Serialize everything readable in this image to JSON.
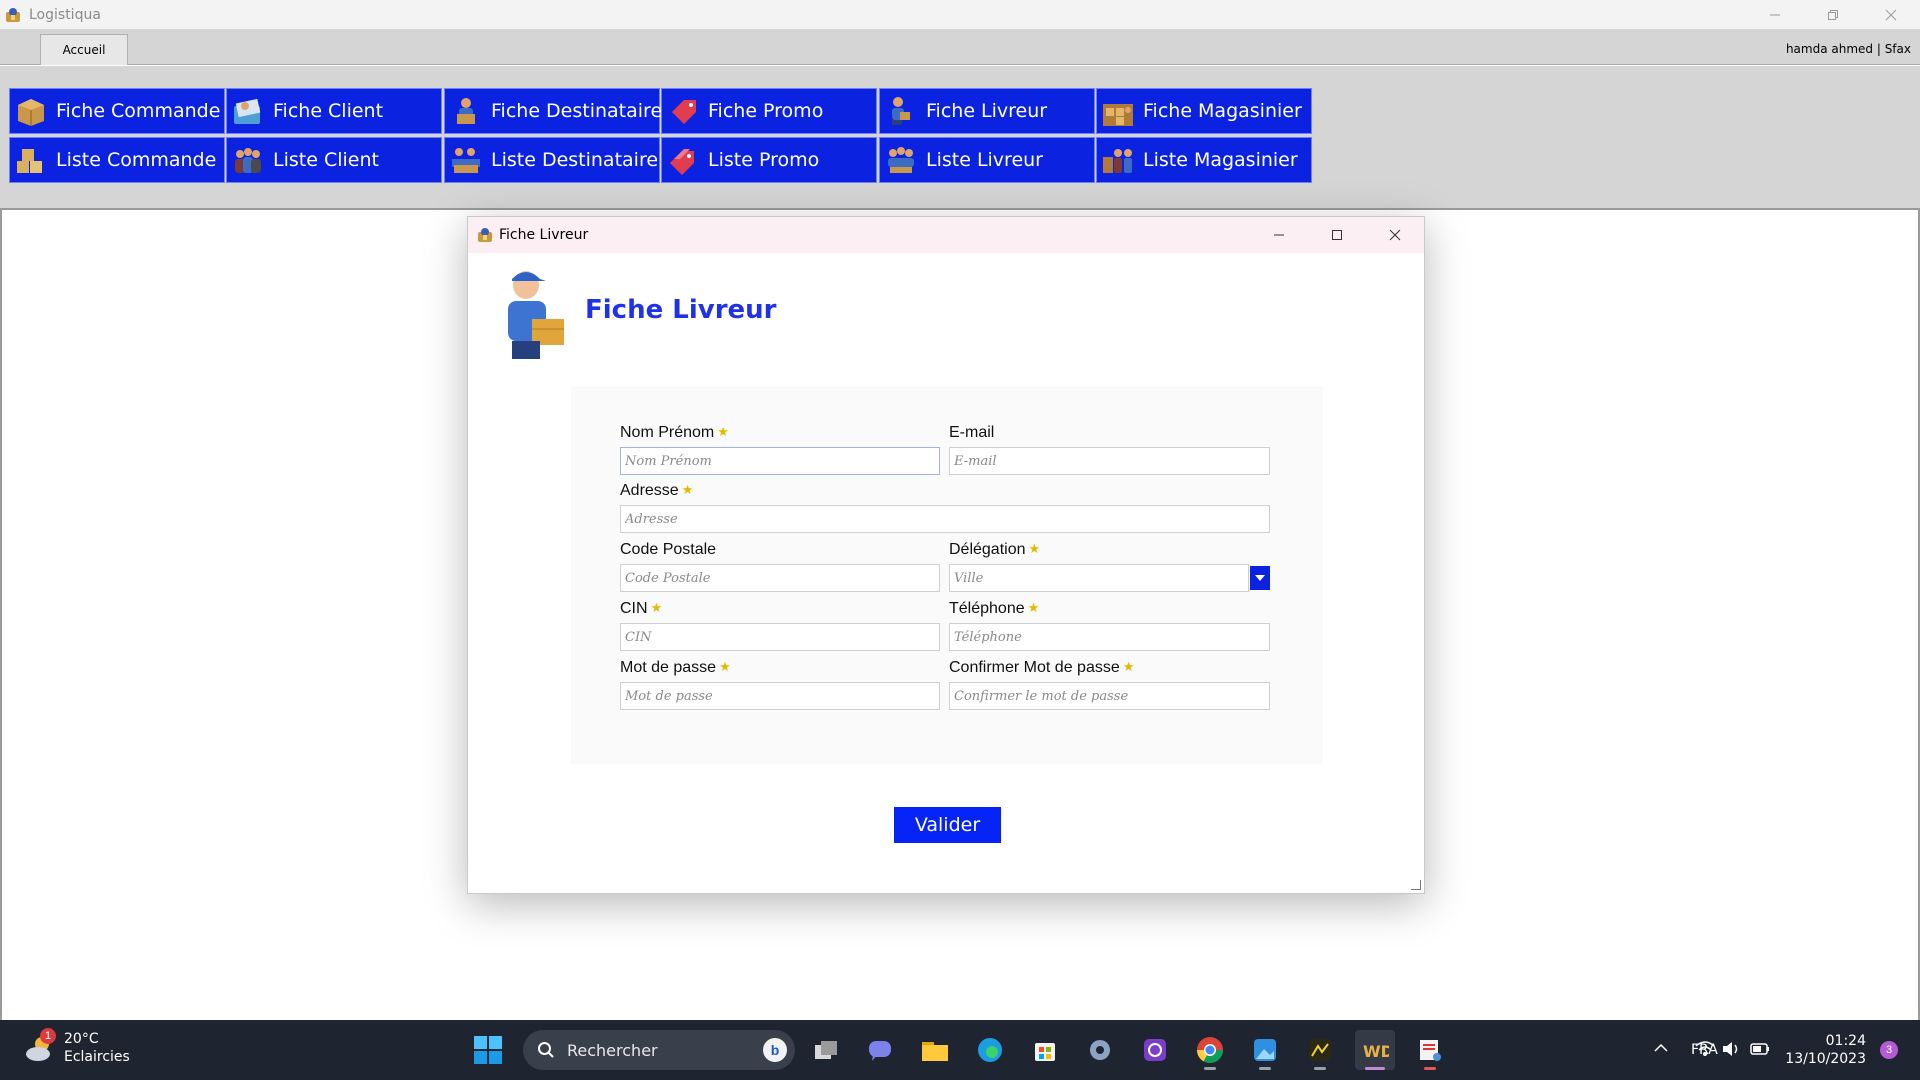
{
  "app": {
    "title": "Logistiqua"
  },
  "ribbon": {
    "tab_label": "Accueil",
    "user_info": "hamda ahmed | Sfax"
  },
  "toolbar": {
    "row1": [
      {
        "label": "Fiche Commande",
        "icon": "box-icon"
      },
      {
        "label": "Fiche Client",
        "icon": "client-card-icon"
      },
      {
        "label": "Fiche Destinataire",
        "icon": "recipient-icon"
      },
      {
        "label": "Fiche Promo",
        "icon": "promo-tag-icon"
      },
      {
        "label": "Fiche Livreur",
        "icon": "delivery-man-icon"
      },
      {
        "label": "Fiche Magasinier",
        "icon": "warehouse-icon"
      }
    ],
    "row2": [
      {
        "label": "Liste Commande",
        "icon": "boxes-icon"
      },
      {
        "label": "Liste Client",
        "icon": "clients-group-icon"
      },
      {
        "label": "Liste Destinataire",
        "icon": "recipients-icon"
      },
      {
        "label": "Liste Promo",
        "icon": "promo-tags-icon"
      },
      {
        "label": "Liste Livreur",
        "icon": "delivery-team-icon"
      },
      {
        "label": "Liste Magasinier",
        "icon": "warehouse-team-icon"
      }
    ]
  },
  "dialog": {
    "window_title": "Fiche Livreur",
    "heading": "Fiche Livreur",
    "fields": {
      "nom_prenom": {
        "label": "Nom Prénom",
        "placeholder": "Nom Prénom",
        "required": true
      },
      "email": {
        "label": "E-mail",
        "placeholder": "E-mail",
        "required": false
      },
      "adresse": {
        "label": "Adresse",
        "placeholder": "Adresse",
        "required": true
      },
      "code_postale": {
        "label": "Code Postale",
        "placeholder": "Code Postale",
        "required": false
      },
      "delegation": {
        "label": "Délégation",
        "placeholder": "Ville",
        "required": true
      },
      "cin": {
        "label": "CIN",
        "placeholder": "CIN",
        "required": true
      },
      "telephone": {
        "label": "Téléphone",
        "placeholder": "Téléphone",
        "required": true
      },
      "mot_de_passe": {
        "label": "Mot de passe",
        "placeholder": "Mot de passe",
        "required": true
      },
      "confirmer": {
        "label": "Confirmer Mot de passe",
        "placeholder": "Confirmer le mot de passe",
        "required": true
      }
    },
    "submit_label": "Valider"
  },
  "taskbar": {
    "weather": {
      "badge": "1",
      "temp": "20°C",
      "condition": "Eclaircies"
    },
    "search_label": "Rechercher",
    "language": "FRA",
    "time": "01:24",
    "date": "13/10/2023",
    "notifications": "3"
  },
  "colors": {
    "accent_blue": "#0b23e0",
    "heading_blue": "#1f32e8",
    "required_star": "#e6b800"
  }
}
